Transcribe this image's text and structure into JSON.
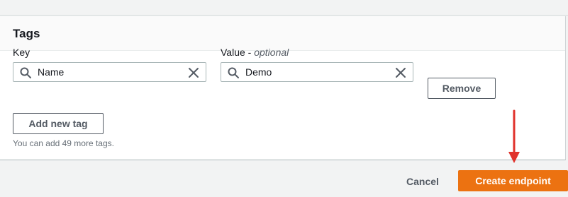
{
  "tags_section": {
    "title": "Tags",
    "key_label": "Key",
    "value_label": "Value - ",
    "value_optional": "optional",
    "key_value": "Name",
    "value_value": "Demo",
    "remove_label": "Remove",
    "add_tag_label": "Add new tag",
    "helper_text": "You can add 49 more tags."
  },
  "footer": {
    "cancel_label": "Cancel",
    "create_label": "Create endpoint"
  },
  "colors": {
    "primary": "#ec7211",
    "annotation_arrow": "#e0322b"
  },
  "icons": [
    "search-icon",
    "clear-icon",
    "arrow-annotation"
  ]
}
